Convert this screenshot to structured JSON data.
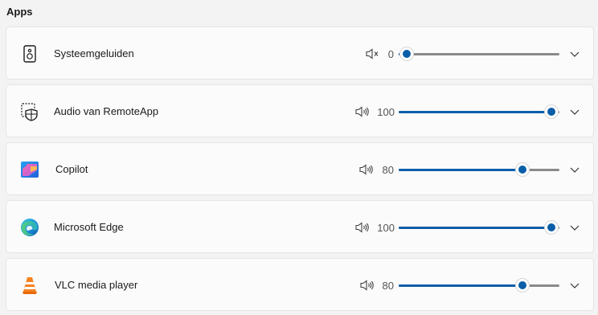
{
  "section": {
    "title": "Apps"
  },
  "apps": [
    {
      "name": "Systeemgeluiden",
      "icon": "speaker-device-icon",
      "volume": 0,
      "volume_label": "0",
      "muted": true
    },
    {
      "name": "Audio van RemoteApp",
      "icon": "remoteapp-shield-icon",
      "volume": 100,
      "volume_label": "100",
      "muted": false
    },
    {
      "name": "Copilot",
      "icon": "copilot-icon",
      "volume": 80,
      "volume_label": "80",
      "muted": false
    },
    {
      "name": "Microsoft Edge",
      "icon": "edge-icon",
      "volume": 100,
      "volume_label": "100",
      "muted": false
    },
    {
      "name": "VLC media player",
      "icon": "vlc-cone-icon",
      "volume": 80,
      "volume_label": "80",
      "muted": false
    }
  ],
  "colors": {
    "accent": "#0a5ea8",
    "track": "#8a8a8a",
    "card": "#fbfbfb",
    "background": "#f3f3f3"
  }
}
